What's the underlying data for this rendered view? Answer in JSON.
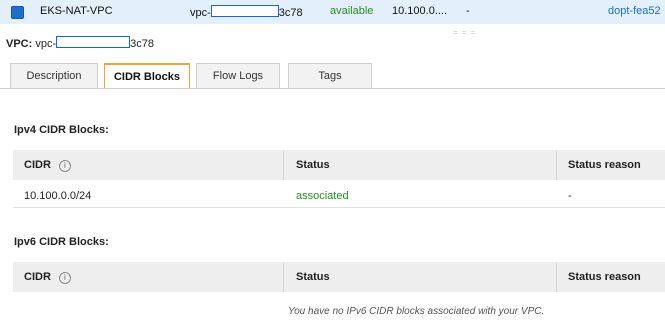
{
  "row": {
    "name": "EKS-NAT-VPC",
    "vpc_id_prefix": "vpc-",
    "vpc_id_suffix": "3c78",
    "state": "available",
    "ipv4_cidr": "10.100.0....",
    "ipv6_cidr": "-",
    "dhcp_options": "dopt-fea52"
  },
  "detail": {
    "label": "VPC:",
    "id_prefix": "vpc-",
    "id_suffix": "3c78"
  },
  "tabs": [
    {
      "label": "Description",
      "active": false
    },
    {
      "label": "CIDR Blocks",
      "active": true
    },
    {
      "label": "Flow Logs",
      "active": false
    },
    {
      "label": "Tags",
      "active": false
    }
  ],
  "ipv4": {
    "title": "Ipv4 CIDR Blocks:",
    "columns": [
      "CIDR",
      "Status",
      "Status reason"
    ],
    "rows": [
      {
        "cidr": "10.100.0.0/24",
        "status": "associated",
        "reason": "-"
      }
    ]
  },
  "ipv6": {
    "title": "Ipv6 CIDR Blocks:",
    "columns": [
      "CIDR",
      "Status",
      "Status reason"
    ],
    "empty_message": "You have no IPv6 CIDR blocks associated with your VPC."
  },
  "icons": {
    "info": "i",
    "grip": "= = ="
  },
  "colors": {
    "selected_row": "#e3effb",
    "checkbox": "#1f6fd1",
    "status_green": "#2a8a2a",
    "tab_accent": "#f0a33a",
    "link": "#1a6fc4"
  }
}
